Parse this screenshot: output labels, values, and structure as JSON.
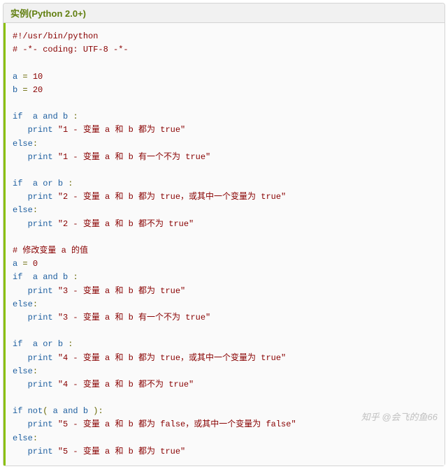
{
  "header": {
    "title": "实例(Python 2.0+)"
  },
  "code": {
    "l01": "#!/usr/bin/python",
    "l02": "# -*- coding: UTF-8 -*-",
    "a_var": "a",
    "b_var": "b",
    "eq": " = ",
    "ten": "10",
    "twenty": "20",
    "zero": "0",
    "if_kw": "if",
    "else_kw": "else",
    "and_kw": "and",
    "or_kw": "or",
    "not_kw": "not",
    "print_kw": "print",
    "colon": ":",
    "lparen": "(",
    "rparen": ")",
    "s1": "\"1 - 变量 a 和 b 都为 true\"",
    "s2": "\"1 - 变量 a 和 b 有一个不为 true\"",
    "s3": "\"2 - 变量 a 和 b 都为 true，或其中一个变量为 true\"",
    "s4": "\"2 - 变量 a 和 b 都不为 true\"",
    "comment_mod": "# 修改变量 a 的值",
    "s5": "\"3 - 变量 a 和 b 都为 true\"",
    "s6": "\"3 - 变量 a 和 b 有一个不为 true\"",
    "s7": "\"4 - 变量 a 和 b 都为 true，或其中一个变量为 true\"",
    "s8": "\"4 - 变量 a 和 b 都不为 true\"",
    "s9": "\"5 - 变量 a 和 b 都为 false，或其中一个变量为 false\"",
    "s10": "\"5 - 变量 a 和 b 都为 true\""
  },
  "watermark": "知乎 @会飞的鱼66"
}
